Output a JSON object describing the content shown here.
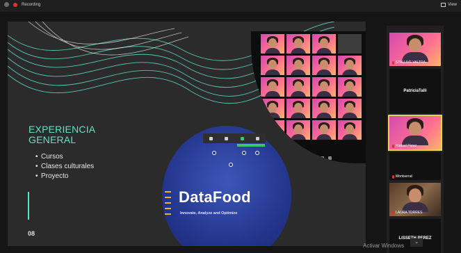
{
  "topbar": {
    "app_label": "Recording",
    "view_label": "View"
  },
  "slide": {
    "title": "EXPERIENCIA GENERAL",
    "bullets": [
      "Cursos",
      "Clases culturales",
      "Proyecto"
    ],
    "page_number": "08",
    "logo_text": "DataFood",
    "tagline": "Innovate, Analyze and Optimize"
  },
  "participants": [
    {
      "name": "STALLIVE VALTRA",
      "type": "video"
    },
    {
      "name": "PatriciaTalli",
      "type": "name-only"
    },
    {
      "name": "Raquel Perez",
      "type": "video"
    },
    {
      "name": "Montserrat",
      "type": "name-only"
    },
    {
      "name": "LAURA TORRES",
      "type": "video"
    },
    {
      "name": "LISSETH PEREZ",
      "type": "name-only"
    }
  ],
  "footer": {
    "activate_text": "Activar Windows"
  },
  "colors": {
    "accent": "#5fe3c4",
    "brand_blue": "#23358b",
    "highlight": "#e6d34a",
    "record": "#e0312f"
  }
}
